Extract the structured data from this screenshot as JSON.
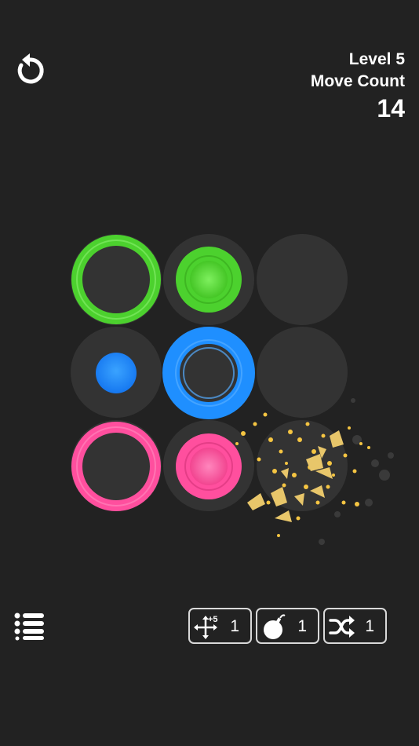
{
  "hud": {
    "level": "Level 5",
    "move_count_label": "Move Count",
    "move_count": "14"
  },
  "board": {
    "rows": 3,
    "cols": 3,
    "cells": [
      {
        "row": 0,
        "col": 0,
        "pieces": [
          {
            "type": "large-ring",
            "color": "green"
          }
        ]
      },
      {
        "row": 0,
        "col": 1,
        "pieces": [
          {
            "type": "medium-ring",
            "color": "green"
          },
          {
            "type": "small-dot",
            "color": "green"
          }
        ]
      },
      {
        "row": 0,
        "col": 2,
        "pieces": []
      },
      {
        "row": 1,
        "col": 0,
        "pieces": [
          {
            "type": "small-dot",
            "color": "blue"
          }
        ]
      },
      {
        "row": 1,
        "col": 1,
        "pieces": [
          {
            "type": "large-ring",
            "color": "blue"
          },
          {
            "type": "medium-ring",
            "color": "blue"
          }
        ]
      },
      {
        "row": 1,
        "col": 2,
        "pieces": []
      },
      {
        "row": 2,
        "col": 0,
        "pieces": [
          {
            "type": "large-ring",
            "color": "pink"
          }
        ]
      },
      {
        "row": 2,
        "col": 1,
        "pieces": [
          {
            "type": "medium-ring",
            "color": "pink"
          },
          {
            "type": "small-dot",
            "color": "pink"
          }
        ]
      },
      {
        "row": 2,
        "col": 2,
        "pieces": [],
        "effect": "gold-sparkle-burst"
      }
    ]
  },
  "colors": {
    "background": "#222222",
    "cell": "#333333",
    "green": "#4cd12e",
    "blue": "#1f8fff",
    "pink": "#ff4f9e",
    "gold": "#f5c542"
  },
  "toolbar": {
    "menu_icon": "list-icon",
    "powerups": [
      {
        "icon": "move-plus-five-icon",
        "count": "1"
      },
      {
        "icon": "bomb-icon",
        "count": "1"
      },
      {
        "icon": "shuffle-icon",
        "count": "1"
      }
    ],
    "move_badge": "+5"
  }
}
